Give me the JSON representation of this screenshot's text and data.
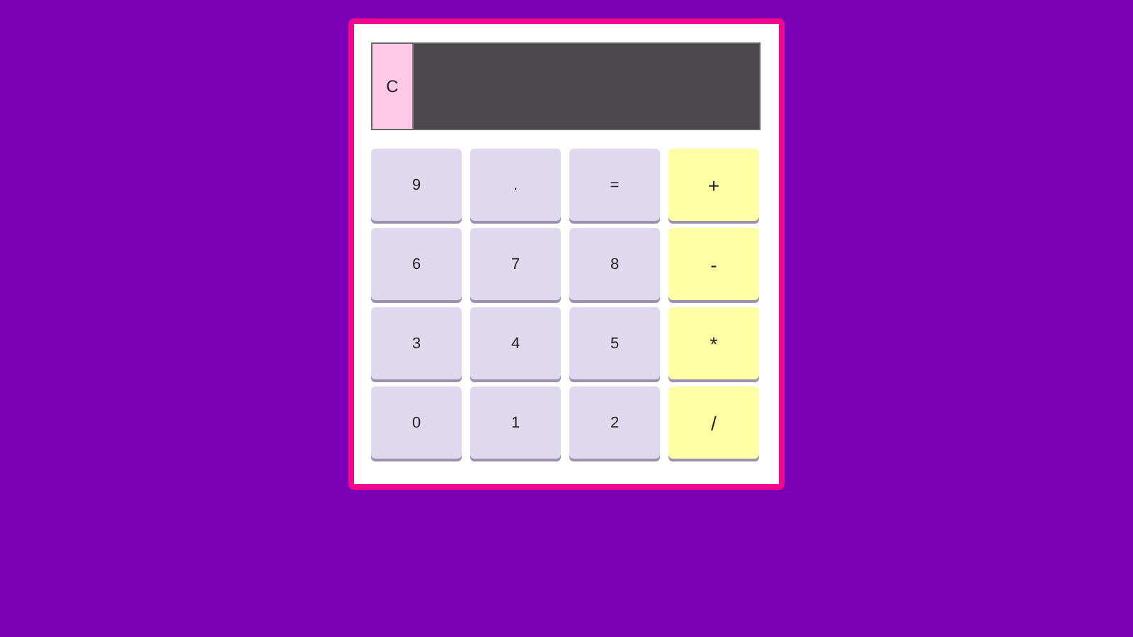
{
  "clear_button": {
    "label": "C"
  },
  "keys": [
    {
      "label": "9",
      "kind": "digit"
    },
    {
      "label": ".",
      "kind": "digit"
    },
    {
      "label": "=",
      "kind": "digit"
    },
    {
      "label": "+",
      "kind": "operator"
    },
    {
      "label": "6",
      "kind": "digit"
    },
    {
      "label": "7",
      "kind": "digit"
    },
    {
      "label": "8",
      "kind": "digit"
    },
    {
      "label": "-",
      "kind": "operator"
    },
    {
      "label": "3",
      "kind": "digit"
    },
    {
      "label": "4",
      "kind": "digit"
    },
    {
      "label": "5",
      "kind": "digit"
    },
    {
      "label": "*",
      "kind": "operator"
    },
    {
      "label": "0",
      "kind": "digit"
    },
    {
      "label": "1",
      "kind": "digit"
    },
    {
      "label": "2",
      "kind": "digit"
    },
    {
      "label": "/",
      "kind": "operator"
    }
  ]
}
